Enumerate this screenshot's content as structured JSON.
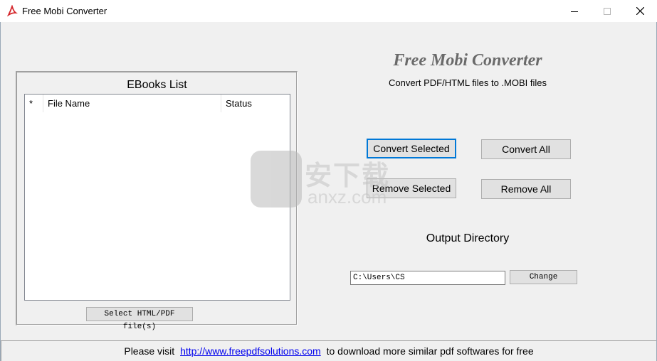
{
  "window": {
    "title": "Free Mobi Converter",
    "controls": {
      "minimize": "minimize-icon",
      "maximize": "maximize-icon",
      "close": "close-icon"
    }
  },
  "ebooks_group": {
    "title": "EBooks List",
    "columns": [
      "*",
      "File Name",
      "Status"
    ],
    "select_button": "Select HTML/PDF file(s)"
  },
  "app_heading": "Free Mobi Converter",
  "app_subheading": "Convert PDF/HTML files to .MOBI files",
  "buttons": {
    "convert_selected": "Convert Selected",
    "convert_all": "Convert All",
    "remove_selected": "Remove Selected",
    "remove_all": "Remove All"
  },
  "output": {
    "label": "Output Directory",
    "path": "C:\\Users\\CS",
    "change": "Change"
  },
  "footer": {
    "prefix": "Please visit",
    "link": "http://www.freepdfsolutions.com",
    "suffix": "to download more similar pdf softwares for free"
  },
  "watermark": {
    "cn": "安下载",
    "sub": "anxz.com"
  },
  "colors": {
    "focus": "#0078d7",
    "link": "#0000ee",
    "heading": "#6a6a6a"
  }
}
